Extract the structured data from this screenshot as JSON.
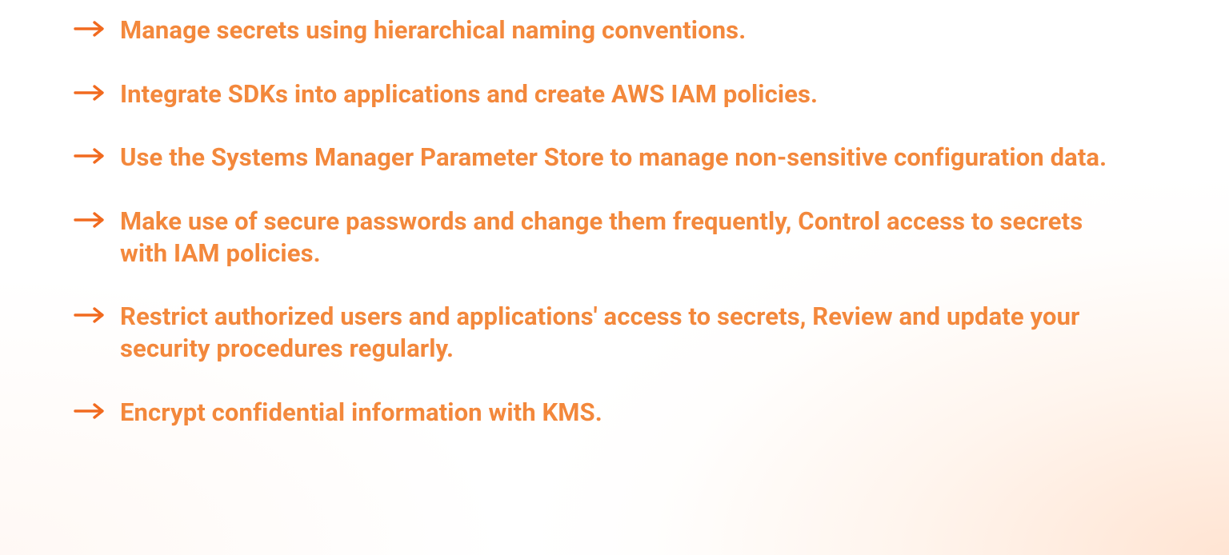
{
  "accent_arrow_color": "#f16a1f",
  "text_color": "#f3883c",
  "list": {
    "items": [
      {
        "text": "Manage secrets using hierarchical naming conventions."
      },
      {
        "text": "Integrate SDKs into applications and create AWS IAM policies."
      },
      {
        "text": "Use the Systems Manager Parameter Store to manage non-sensitive configuration data."
      },
      {
        "text": "Make use of secure passwords and change them frequently, Control access to secrets with IAM policies."
      },
      {
        "text": "Restrict authorized users and applications' access to secrets, Review and update your security procedures regularly."
      },
      {
        "text": "Encrypt confidential information with KMS."
      }
    ]
  }
}
